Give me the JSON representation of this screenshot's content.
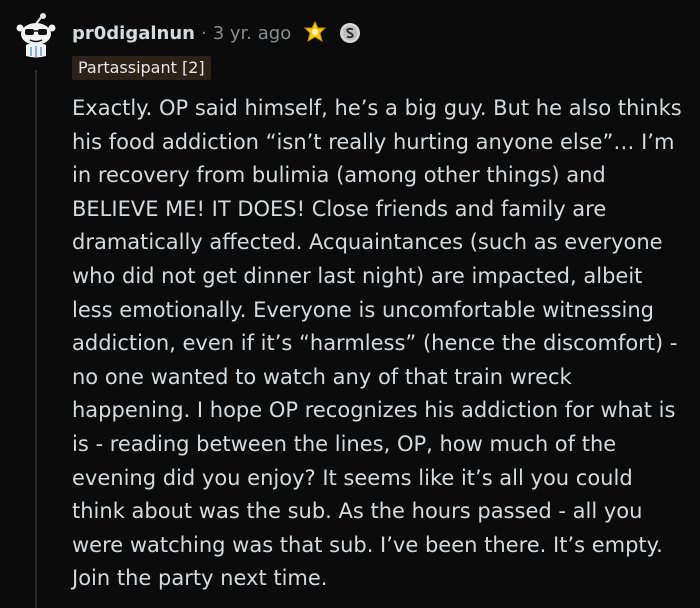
{
  "comment": {
    "username": "pr0digalnun",
    "separator": "·",
    "timestamp": "3 yr. ago",
    "flair": "Partassipant [2]",
    "icons": {
      "avatar": "snoo-avatar-icon",
      "award": "gold-award-icon",
      "coin": "coin-s-icon"
    },
    "body": "Exactly. OP said himself, he’s a big guy. But he also thinks his food addiction “isn’t really hurting anyone else”… I’m in recovery from bulimia (among other things) and BELIEVE ME! IT DOES! Close friends and family are dramatically affected. Acquaintances (such as everyone who did not get dinner last night) are impacted, albeit less emotionally. Everyone is uncomfortable witnessing addiction, even if it’s “harmless” (hence the discomfort) - no one wanted to watch any of that train wreck happening. I hope OP recognizes his addiction for what is is - reading between the lines, OP, how much of the evening did you enjoy? It seems like it’s all you could think about was the sub. As the hours passed - all you were watching was that sub. I’ve been there. It’s empty. Join the party next time."
  },
  "colors": {
    "background": "#0b0b0b",
    "text": "#d7dadc",
    "muted": "#8a8d8f",
    "flair_bg": "#2d2218",
    "award_gold": "#f5c518"
  }
}
